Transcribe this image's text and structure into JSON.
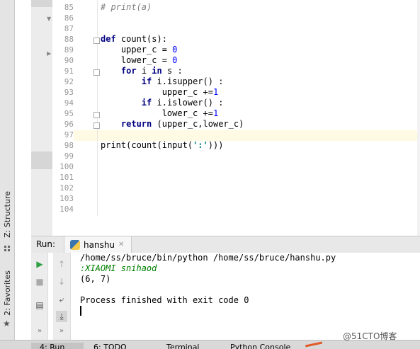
{
  "sidebar": {
    "structure_label": "Z: Structure",
    "favorites_label": "2: Favorites"
  },
  "editor": {
    "line_numbers": [
      "85",
      "86",
      "87",
      "88",
      "89",
      "90",
      "91",
      "92",
      "93",
      "94",
      "95",
      "96",
      "97",
      "98",
      "99",
      "100",
      "101",
      "102",
      "103",
      "104"
    ],
    "lines": [
      "# print(a)",
      "",
      "",
      "def count(s):",
      "    upper_c = 0",
      "    lower_c = 0",
      "    for i in s :",
      "        if i.isupper() :",
      "            upper_c +=1",
      "        if i.islower() :",
      "            lower_c +=1",
      "    return (upper_c,lower_c)",
      "",
      "print(count(input(':')))",
      "",
      "",
      "",
      "",
      "",
      ""
    ]
  },
  "run_panel": {
    "title": "Run:",
    "tab_label": "hanshu",
    "console_lines": [
      "/home/ss/bruce/bin/python /home/ss/bruce/hanshu.py",
      ":XIAOMI snihaod",
      "(6, 7)",
      "",
      "Process finished with exit code 0"
    ]
  },
  "bottom_tabs": [
    "4: Run",
    "6: TODO",
    "Terminal",
    "Python Console"
  ],
  "watermark": "@51CTO博客",
  "colors": {
    "keyword": "#000080",
    "number": "#0000ff",
    "comment": "#808080",
    "string": "#008080",
    "input_text": "#007f00",
    "current_line": "#fffae3"
  }
}
